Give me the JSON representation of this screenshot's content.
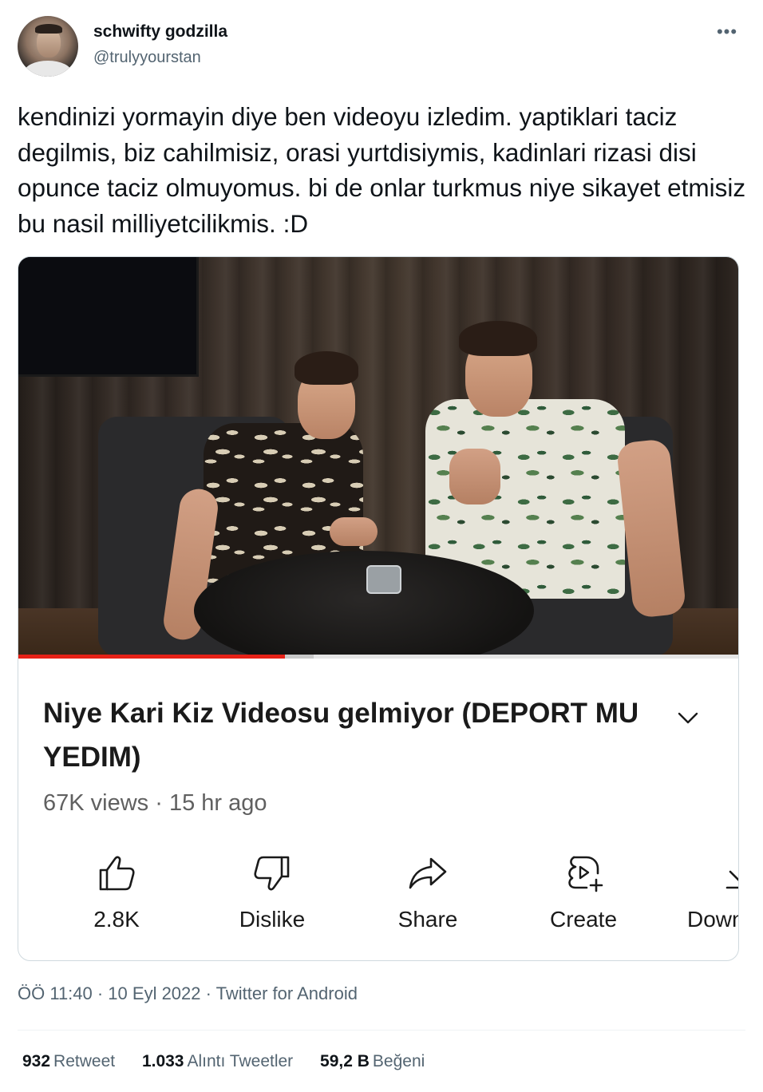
{
  "author": {
    "display_name": "schwifty godzilla",
    "handle": "@trulyyourstan"
  },
  "icons": {
    "more": "more-horizontal-icon",
    "expand": "chevron-down-icon",
    "like": "thumbs-up-icon",
    "dislike": "thumbs-down-icon",
    "share": "share-arrow-icon",
    "create": "create-clip-icon",
    "download": "download-icon"
  },
  "tweet": {
    "text": "kendinizi yormayin diye ben videoyu izledim. yaptiklari taciz degilmis, biz cahilmisiz, orasi yurtdisiymis, kadinlari rizasi disi opunce taciz olmuyomus. bi de onlar turkmus niye sikayet etmisiz bu nasil milliyetcilikmis. :D"
  },
  "video": {
    "progress_played": 0.37,
    "progress_buffered": 0.41,
    "title": "Niye Kari Kiz Videosu gelmiyor (DEPORT MU YEDIM)",
    "meta": "67K views · 15 hr ago",
    "accent_color": "#e62117",
    "actions": {
      "like_label": "2.8K",
      "dislike_label": "Dislike",
      "share_label": "Share",
      "create_label": "Create",
      "download_label": "Down"
    }
  },
  "footer": {
    "timestamp": "ÖÖ 11:40 · 10 Eyl 2022 · Twitter for Android",
    "stats": {
      "retweets_count": "932",
      "retweets_label": "Retweet",
      "quotes_count": "1.033",
      "quotes_label": "Alıntı Tweetler",
      "likes_count": "59,2 B",
      "likes_label": "Beğeni"
    }
  }
}
